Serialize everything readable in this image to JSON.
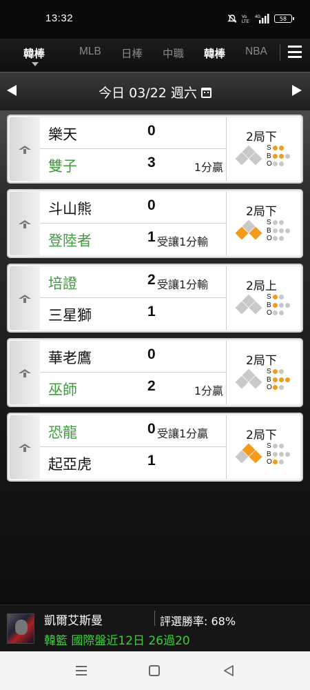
{
  "status_bar": {
    "time": "13:32",
    "icons": [
      "mute-icon",
      "volte-icon",
      "4g-signal-icon"
    ],
    "battery": "58"
  },
  "category_nav": {
    "tabs": [
      {
        "label": "韓棒",
        "active": true
      },
      {
        "label": "MLB",
        "active": false
      },
      {
        "label": "日棒",
        "active": false
      },
      {
        "label": "中職",
        "active": false
      },
      {
        "label": "韓棒",
        "active": false
      },
      {
        "label": "NBA",
        "active": false
      }
    ]
  },
  "date_bar": {
    "label": "今日 03/22 週六"
  },
  "colors": {
    "accent": "#f39a1a",
    "favorite_green": "#3f9b3f",
    "record_green": "#3ccf3c"
  },
  "games": [
    {
      "top": {
        "name": "樂天",
        "score": "0",
        "note": "",
        "favored": false
      },
      "bottom": {
        "name": "雙子",
        "score": "3",
        "note": "1分贏",
        "favored": true
      },
      "inning": "2局下",
      "bases": [
        false,
        false,
        false
      ],
      "strikes": 2,
      "balls": 2,
      "outs": 0
    },
    {
      "top": {
        "name": "斗山熊",
        "score": "0",
        "note": "",
        "favored": false
      },
      "bottom": {
        "name": "登陸者",
        "score": "1",
        "note": "受讓1分輸",
        "favored": true
      },
      "inning": "2局下",
      "bases": [
        true,
        false,
        true
      ],
      "strikes": 0,
      "balls": 0,
      "outs": 0
    },
    {
      "top": {
        "name": "培證",
        "score": "2",
        "note": "受讓1分輸",
        "favored": true
      },
      "bottom": {
        "name": "三星獅",
        "score": "1",
        "note": "",
        "favored": false
      },
      "inning": "2局上",
      "bases": [
        false,
        false,
        false
      ],
      "strikes": 1,
      "balls": 1,
      "outs": 0
    },
    {
      "top": {
        "name": "華老鷹",
        "score": "0",
        "note": "",
        "favored": false
      },
      "bottom": {
        "name": "巫師",
        "score": "2",
        "note": "1分贏",
        "favored": true
      },
      "inning": "2局下",
      "bases": [
        false,
        false,
        false
      ],
      "strikes": 1,
      "balls": 3,
      "outs": 1
    },
    {
      "top": {
        "name": "恐龍",
        "score": "0",
        "note": "受讓1分贏",
        "favored": true
      },
      "bottom": {
        "name": "起亞虎",
        "score": "1",
        "note": "",
        "favored": false
      },
      "inning": "2局下",
      "bases": [
        true,
        true,
        false
      ],
      "strikes": 0,
      "balls": 0,
      "outs": 1
    }
  ],
  "promo": {
    "name": "凱爾艾斯曼",
    "rate_label": "評選勝率: 68%",
    "record": "韓籃 國際盤近12日 26過20"
  }
}
